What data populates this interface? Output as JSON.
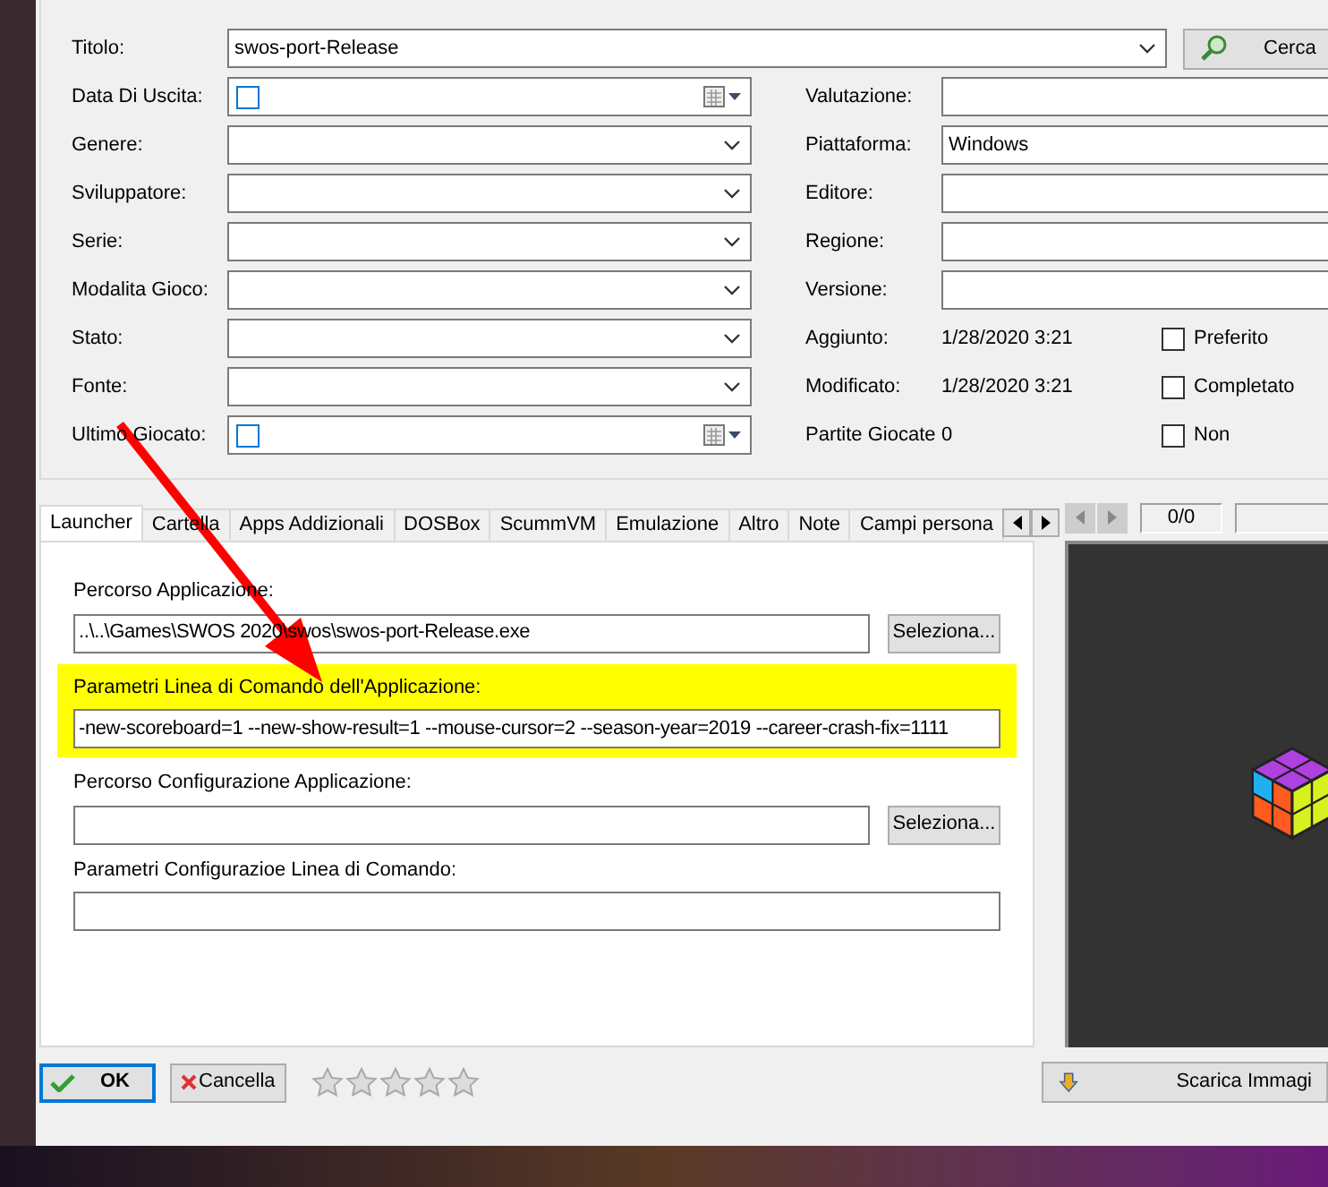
{
  "details": {
    "title": {
      "label": "Titolo:",
      "value": "swos-port-Release",
      "search_button": "Cerca"
    },
    "left_fields": [
      {
        "label": "Data Di Uscita:",
        "kind": "date",
        "checked": false
      },
      {
        "label": "Genere:",
        "kind": "combo"
      },
      {
        "label": "Sviluppatore:",
        "kind": "combo"
      },
      {
        "label": "Serie:",
        "kind": "combo"
      },
      {
        "label": "Modalita Gioco:",
        "kind": "combo"
      },
      {
        "label": "Stato:",
        "kind": "combo"
      },
      {
        "label": "Fonte:",
        "kind": "combo"
      },
      {
        "label": "Ultimo Giocato:",
        "kind": "date",
        "checked": false
      }
    ],
    "right_fields": [
      {
        "label": "Valutazione:",
        "kind": "text"
      },
      {
        "label": "Piattaforma:",
        "kind": "text",
        "value": "Windows"
      },
      {
        "label": "Editore:",
        "kind": "text"
      },
      {
        "label": "Regione:",
        "kind": "text"
      },
      {
        "label": "Versione:",
        "kind": "text"
      },
      {
        "label": "Aggiunto:",
        "kind": "info",
        "value": "1/28/2020 3:21",
        "checkbox": {
          "label": "Preferito",
          "checked": false
        }
      },
      {
        "label": "Modificato:",
        "kind": "info",
        "value": "1/28/2020 3:21",
        "checkbox": {
          "label": "Completato",
          "checked": false
        }
      },
      {
        "label": "Partite Giocate",
        "kind": "info",
        "value": "0",
        "checkbox": {
          "label": "Non",
          "checked": false
        }
      }
    ]
  },
  "tabs": [
    {
      "label": "Launcher",
      "selected": true
    },
    {
      "label": "Cartella",
      "selected": false
    },
    {
      "label": "Apps Addizionali",
      "selected": false
    },
    {
      "label": "DOSBox",
      "selected": false
    },
    {
      "label": "ScummVM",
      "selected": false
    },
    {
      "label": "Emulazione",
      "selected": false
    },
    {
      "label": "Altro",
      "selected": false
    },
    {
      "label": "Note",
      "selected": false
    },
    {
      "label": "Campi persona",
      "selected": false
    }
  ],
  "launcher": [
    {
      "label": "Percorso Applicazione:",
      "value": "..\\..\\Games\\SWOS 2020\\swos\\swos-port-Release.exe",
      "button": "Seleziona...",
      "highlighted": false
    },
    {
      "label": "Parametri Linea di Comando dell'Applicazione:",
      "value": "-new-scoreboard=1 --new-show-result=1 --mouse-cursor=2 --season-year=2019 --career-crash-fix=1111",
      "highlighted": true
    },
    {
      "label": "Percorso Configurazione Applicazione:",
      "button": "Seleziona...",
      "highlighted": false
    },
    {
      "label": "Parametri Configurazioe Linea di Comando:",
      "highlighted": false
    }
  ],
  "images": {
    "counter": "0/0",
    "download_button": "Scarica Immagi"
  },
  "footer": {
    "ok": "OK",
    "cancel": "Cancella",
    "rating": {
      "stars": 0
    }
  }
}
